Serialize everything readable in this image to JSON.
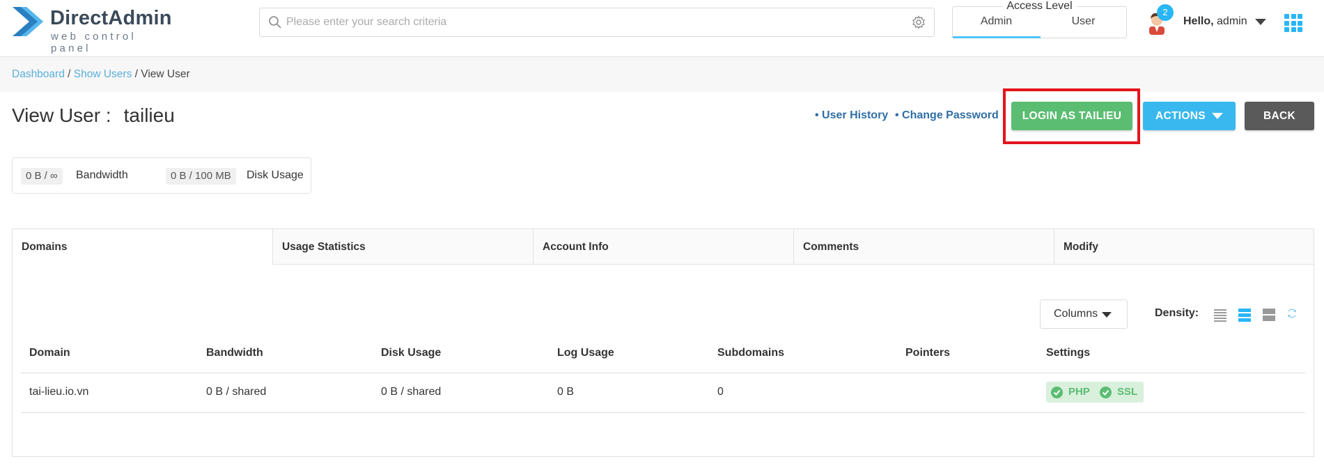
{
  "header": {
    "logo": {
      "title": "DirectAdmin",
      "subtitle": "web control panel"
    },
    "search": {
      "placeholder": "Please enter your search criteria",
      "icon": "search-icon",
      "settings_icon": "gear-icon"
    },
    "access_level": {
      "label": "Access Level",
      "tabs": [
        "Admin",
        "User"
      ],
      "selected": "Admin"
    },
    "notifications": {
      "count": "2"
    },
    "greeting": {
      "hello": "Hello,",
      "user": "admin"
    },
    "apps_icon": "grid-icon",
    "accent_color": "#29b6f6"
  },
  "breadcrumb": {
    "items": [
      "Dashboard",
      "Show Users",
      "View User"
    ],
    "separator": "/"
  },
  "page": {
    "title_prefix": "View User :",
    "username": "tailieu",
    "links": [
      "• User History",
      "• Change Password"
    ],
    "buttons": {
      "login": "LOGIN AS TAILIEU",
      "actions": "ACTIONS",
      "back": "BACK"
    },
    "highlight_color": "#e3141e"
  },
  "stats": [
    {
      "value": "0 B / ∞",
      "label": "Bandwidth"
    },
    {
      "value": "0 B / 100 MB",
      "label": "Disk Usage"
    }
  ],
  "tabs": [
    "Domains",
    "Usage Statistics",
    "Account Info",
    "Comments",
    "Modify"
  ],
  "active_tab": "Domains",
  "table_tools": {
    "columns_label": "Columns",
    "density_label": "Density:",
    "density_selected": "medium"
  },
  "table": {
    "headers": [
      "Domain",
      "Bandwidth",
      "Disk Usage",
      "Log Usage",
      "Subdomains",
      "Pointers",
      "Settings"
    ],
    "rows": [
      {
        "domain": "tai-lieu.io.vn",
        "bandwidth": "0 B / shared",
        "disk_usage": "0 B / shared",
        "log_usage": "0 B",
        "subdomains": "0",
        "pointers": "",
        "settings": [
          "PHP",
          "SSL"
        ]
      }
    ]
  },
  "colors": {
    "success": "#5bbd72",
    "info": "#38b8ee",
    "dark": "#5a5a5a",
    "link": "#5aaedc"
  }
}
